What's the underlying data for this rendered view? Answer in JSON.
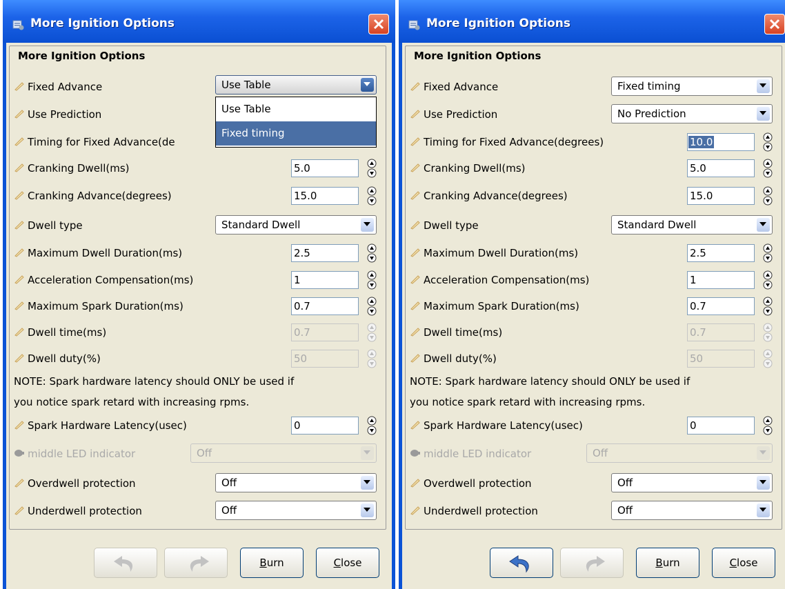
{
  "windows": [
    {
      "title": "More Ignition Options",
      "group_title": "More Ignition Options",
      "fixed_advance": "Use Table",
      "use_prediction": "",
      "timing_fixed": "",
      "cranking_dwell": "5.0",
      "cranking_advance": "15.0",
      "dwell_type": "Standard Dwell",
      "max_dwell": "2.5",
      "accel_comp": "1",
      "max_spark": "0.7",
      "dwell_time": "0.7",
      "dwell_duty": "50",
      "spark_latency": "0",
      "middle_led": "Off",
      "overdwell": "Off",
      "underdwell": "Off",
      "dropdown_options": [
        "Use Table",
        "Fixed timing"
      ],
      "dropdown_selected": "Fixed timing"
    },
    {
      "title": "More Ignition Options",
      "group_title": "More Ignition Options",
      "fixed_advance": "Fixed timing",
      "use_prediction": "No Prediction",
      "timing_fixed": "10.0",
      "cranking_dwell": "5.0",
      "cranking_advance": "15.0",
      "dwell_type": "Standard Dwell",
      "max_dwell": "2.5",
      "accel_comp": "1",
      "max_spark": "0.7",
      "dwell_time": "0.7",
      "dwell_duty": "50",
      "spark_latency": "0",
      "middle_led": "Off",
      "overdwell": "Off",
      "underdwell": "Off"
    }
  ],
  "labels": {
    "fixed_advance": "Fixed Advance",
    "use_prediction": "Use Prediction",
    "timing_fixed": "Timing for Fixed Advance(degrees)",
    "timing_fixed_clipped": "Timing for Fixed Advance(de",
    "cranking_dwell": "Cranking Dwell(ms)",
    "cranking_advance": "Cranking Advance(degrees)",
    "dwell_type": "Dwell type",
    "max_dwell": "Maximum Dwell Duration(ms)",
    "accel_comp": "Acceleration Compensation(ms)",
    "max_spark": "Maximum Spark Duration(ms)",
    "dwell_time": "Dwell time(ms)",
    "dwell_duty": "Dwell duty(%)",
    "note_line1": "NOTE: Spark hardware latency should ONLY be used if",
    "note_line2": "you notice spark retard with increasing rpms.",
    "spark_latency": "Spark Hardware Latency(usec)",
    "middle_led": "middle LED indicator",
    "overdwell": "Overdwell protection",
    "underdwell": "Underdwell protection"
  },
  "buttons": {
    "burn_u": "B",
    "burn_rest": "urn",
    "close_u": "C",
    "close_rest": "lose"
  },
  "icons": {
    "label_icon": "pencil-icon",
    "led_icon": "led-icon",
    "undo": "undo-icon",
    "redo": "redo-icon"
  },
  "colors": {
    "title_bar": "#1c63e8",
    "client_bg": "#ece9d8",
    "selection": "#4a6fa5",
    "close_button": "#d74222"
  }
}
